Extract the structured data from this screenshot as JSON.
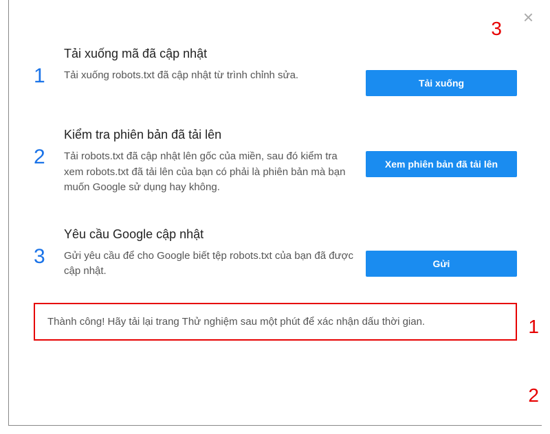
{
  "steps": [
    {
      "num": "1",
      "title": "Tải xuống mã đã cập nhật",
      "desc": "Tải xuống robots.txt đã cập nhật từ trình chỉnh sửa.",
      "button": "Tải xuống"
    },
    {
      "num": "2",
      "title": "Kiểm tra phiên bản đã tải lên",
      "desc": "Tải robots.txt đã cập nhật lên gốc của miền, sau đó kiểm tra xem robots.txt đã tải lên của bạn có phải là phiên bản mà bạn muốn Google sử dụng hay không.",
      "button": "Xem phiên bản đã tải lên"
    },
    {
      "num": "3",
      "title": "Yêu cầu Google cập nhật",
      "desc": "Gửi yêu cầu để cho Google biết tệp robots.txt của bạn đã được cập nhật.",
      "button": "Gửi"
    }
  ],
  "success_message": "Thành công! Hãy tải lại trang Thử nghiệm sau một phút để xác nhận dấu thời gian.",
  "annotations": {
    "top": "3",
    "right_mid": "1",
    "right_bottom": "2"
  },
  "close_glyph": "×"
}
